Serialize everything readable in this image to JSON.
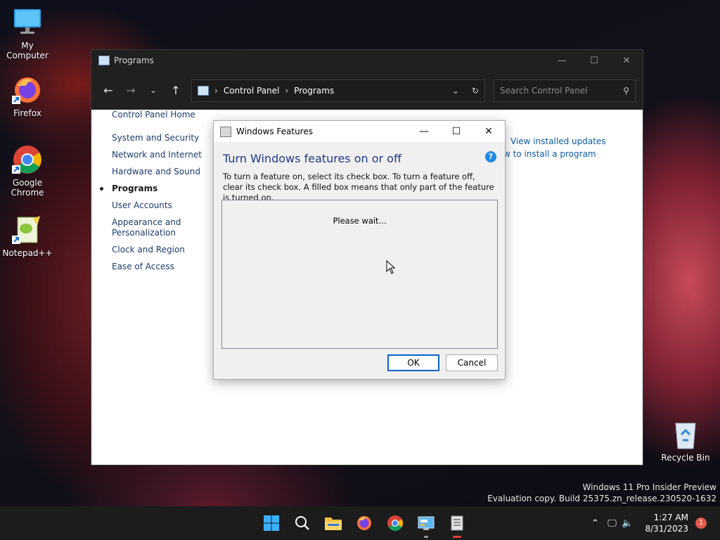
{
  "desktop": {
    "icons": [
      {
        "label": "My Computer"
      },
      {
        "label": "Firefox"
      },
      {
        "label": "Google Chrome"
      },
      {
        "label": "Notepad++"
      }
    ],
    "recycle_bin": "Recycle Bin",
    "watermark_line1": "Windows 11 Pro Insider Preview",
    "watermark_line2": "Evaluation copy. Build 25375.zn_release.230520-1632"
  },
  "explorer": {
    "title": "Programs",
    "breadcrumb": [
      "Control Panel",
      "Programs"
    ],
    "search_placeholder": "Search Control Panel",
    "sidebar": [
      {
        "label": "Control Panel Home"
      },
      {
        "label": "System and Security"
      },
      {
        "label": "Network and Internet"
      },
      {
        "label": "Hardware and Sound"
      },
      {
        "label": "Programs",
        "active": true
      },
      {
        "label": "User Accounts"
      },
      {
        "label": "Appearance and Personalization"
      },
      {
        "label": "Clock and Region"
      },
      {
        "label": "Ease of Access"
      }
    ],
    "links": {
      "view_updates": "View installed updates",
      "how_to_install": "w to install a program"
    }
  },
  "dialog": {
    "title": "Windows Features",
    "heading": "Turn Windows features on or off",
    "description": "To turn a feature on, select its check box. To turn a feature off, clear its check box. A filled box means that only part of the feature is turned on.",
    "status": "Please wait...",
    "ok_label": "OK",
    "cancel_label": "Cancel"
  },
  "taskbar": {
    "apps": [
      "start",
      "search",
      "file-explorer",
      "firefox",
      "chrome",
      "control-panel",
      "windows-features"
    ],
    "time": "1:27 AM",
    "date": "8/31/2023",
    "notification_count": "1"
  },
  "colors": {
    "accent": "#0a64c8",
    "link": "#0b5cad",
    "heading": "#1e3a8a",
    "taskbar": "#1c1c1c"
  }
}
